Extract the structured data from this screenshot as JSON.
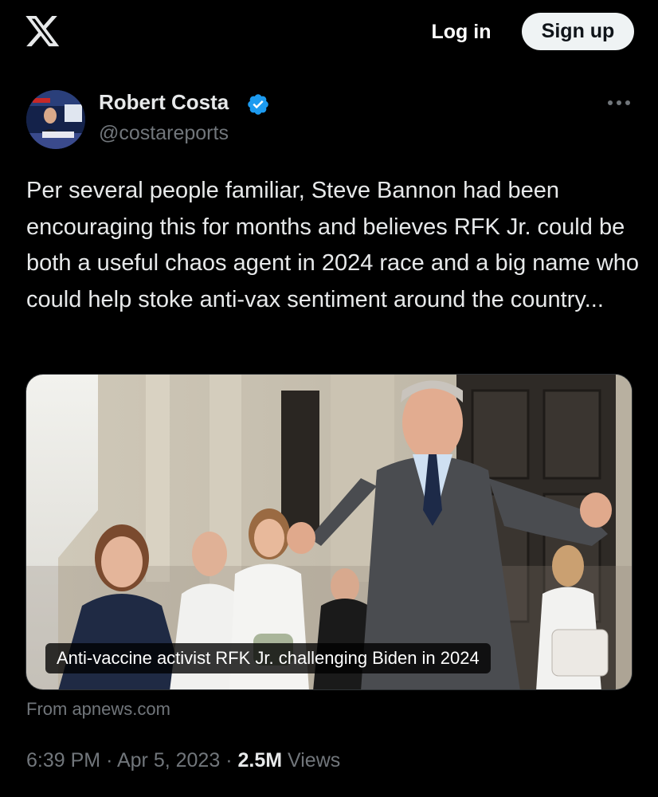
{
  "header": {
    "logo_icon": "x-logo-icon",
    "login_label": "Log in",
    "signup_label": "Sign up"
  },
  "tweet": {
    "author_name": "Robert Costa",
    "verified_icon": "verified-badge-icon",
    "verified_color": "#1d9bf0",
    "handle": "@costareports",
    "more_icon": "more-options-icon",
    "text": "Per several people familiar, Steve Bannon had been encouraging this for months and believes RFK Jr. could be both a useful chaos agent in 2024 race and a big name who could help stoke anti-vax sentiment around the country...",
    "card": {
      "caption": "Anti-vaccine activist RFK Jr. challenging Biden in 2024",
      "source": "From apnews.com"
    },
    "time": "6:39 PM",
    "date": "Apr 5, 2023",
    "separator": "·",
    "views_count": "2.5M",
    "views_label": "Views"
  }
}
